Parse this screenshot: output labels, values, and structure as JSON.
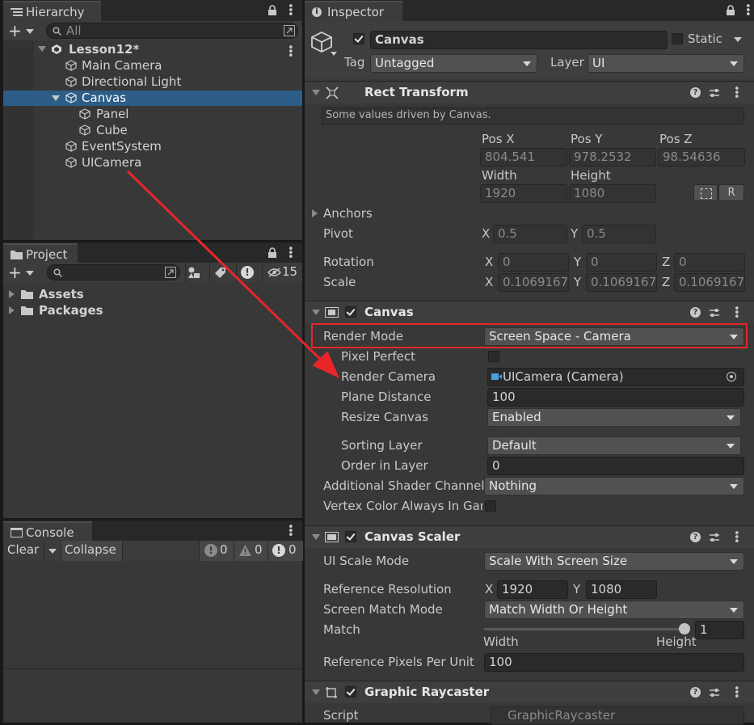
{
  "colors": {
    "accent": "#2c5d87",
    "arrow": "#e8262a",
    "bg": "#383838"
  },
  "hierarchy": {
    "tab": "Hierarchy",
    "search_placeholder": "All",
    "scene": "Lesson12*",
    "items": [
      "Main Camera",
      "Directional Light",
      "Canvas",
      "Panel",
      "Cube",
      "EventSystem",
      "UICamera"
    ]
  },
  "project": {
    "tab": "Project",
    "hidden_count": "15",
    "folders": [
      "Assets",
      "Packages"
    ]
  },
  "console": {
    "tab": "Console",
    "clear": "Clear",
    "collapse": "Collapse",
    "info_count": "0",
    "warn_count": "0",
    "error_count": "0"
  },
  "inspector": {
    "tab": "Inspector",
    "object_name": "Canvas",
    "static_label": "Static",
    "tag_label": "Tag",
    "tag_value": "Untagged",
    "layer_label": "Layer",
    "layer_value": "UI",
    "rect": {
      "title": "Rect Transform",
      "note": "Some values driven by Canvas.",
      "posx_label": "Pos X",
      "posy_label": "Pos Y",
      "posz_label": "Pos Z",
      "posx": "804.541",
      "posy": "978.2532",
      "posz": "98.54636",
      "width_label": "Width",
      "height_label": "Height",
      "width": "1920",
      "height": "1080",
      "r_button": "R",
      "anchors": "Anchors",
      "pivot": "Pivot",
      "pivot_x": "0.5",
      "pivot_y": "0.5",
      "rotation": "Rotation",
      "rot_x": "0",
      "rot_y": "0",
      "rot_z": "0",
      "scale": "Scale",
      "scale_x": "0.1069167",
      "scale_y": "0.1069167",
      "scale_z": "0.1069167",
      "x": "X",
      "y": "Y",
      "z": "Z"
    },
    "canvas": {
      "title": "Canvas",
      "render_mode_label": "Render Mode",
      "render_mode": "Screen Space - Camera",
      "pixel_perfect": "Pixel Perfect",
      "render_camera_label": "Render Camera",
      "render_camera": "UICamera (Camera)",
      "plane_distance_label": "Plane Distance",
      "plane_distance": "100",
      "resize_canvas_label": "Resize Canvas",
      "resize_canvas": "Enabled",
      "sorting_layer_label": "Sorting Layer",
      "sorting_layer": "Default",
      "order_label": "Order in Layer",
      "order": "0",
      "shader_channels_label": "Additional Shader Channels",
      "shader_channels": "Nothing",
      "vertex_color_label": "Vertex Color Always In Gam"
    },
    "scaler": {
      "title": "Canvas Scaler",
      "ui_scale_mode_label": "UI Scale Mode",
      "ui_scale_mode": "Scale With Screen Size",
      "ref_res_label": "Reference Resolution",
      "ref_x": "1920",
      "ref_y": "1080",
      "match_mode_label": "Screen Match Mode",
      "match_mode": "Match Width Or Height",
      "match_label": "Match",
      "match_value": "1",
      "match_fraction": 1.0,
      "width": "Width",
      "height": "Height",
      "ppu_label": "Reference Pixels Per Unit",
      "ppu": "100"
    },
    "raycaster": {
      "title": "Graphic Raycaster",
      "script_label": "Script",
      "script_value": "GraphicRaycaster"
    }
  }
}
